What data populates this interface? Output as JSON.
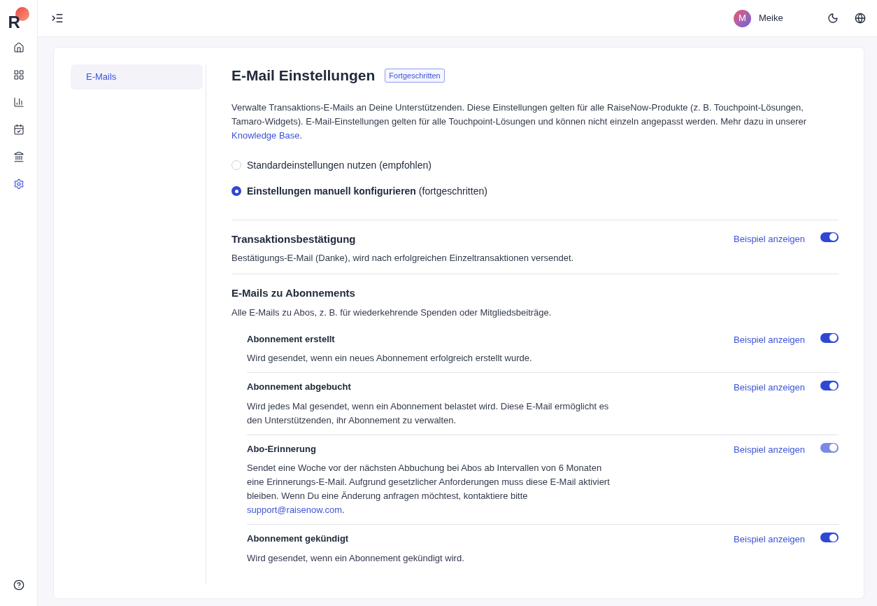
{
  "logo": "R",
  "rail": [
    {
      "kind": "home",
      "selected": false
    },
    {
      "kind": "grid",
      "selected": false
    },
    {
      "kind": "chart",
      "selected": false
    },
    {
      "kind": "calendar",
      "selected": false
    },
    {
      "kind": "bank",
      "selected": false
    },
    {
      "kind": "settings",
      "selected": true
    }
  ],
  "user": {
    "initial": "M",
    "name": "Meike"
  },
  "subnav": [
    {
      "label": "E-Mails",
      "selected": true
    }
  ],
  "title": "E-Mail Einstellungen",
  "badge": "Fortgeschritten",
  "intro": {
    "text": "Verwalte Transaktions-E-Mails an Deine Unterstützenden. Diese Einstellungen gelten für alle RaiseNow-Produkte (z. B. Touchpoint-Lösungen, Tamaro-Widgets). E-Mail-Einstellungen gelten für alle Touchpoint-Lösungen und können nicht einzeln angepasst werden. Mehr dazu in unserer ",
    "link": "Knowledge Base",
    "after": "."
  },
  "options": [
    {
      "label": "Standardeinstellungen nutzen",
      "note": "(empfohlen)",
      "selected": false
    },
    {
      "label": "Einstellungen manuell konfigurieren",
      "note": "(fortgeschritten)",
      "selected": true
    }
  ],
  "sections": [
    {
      "title": "Transaktionsbestätigung",
      "description": "Bestätigungs-E-Mail (Danke), wird nach erfolgreichen Einzeltransaktionen versendet.",
      "example": "Beispiel anzeigen",
      "on": true,
      "disabled": false
    },
    {
      "title": "E-Mails zu Abonnements",
      "description": "Alle E-Mails zu Abos, z. B. für wiederkehrende Spenden oder Mitgliedsbeiträge.",
      "items": [
        {
          "title": "Abonnement erstellt",
          "description": "Wird gesendet, wenn ein neues Abonnement erfolgreich erstellt wurde.",
          "example": "Beispiel anzeigen",
          "on": true,
          "disabled": false
        },
        {
          "title": "Abonnement abgebucht",
          "description": "Wird jedes Mal gesendet, wenn ein Abonnement belastet wird. Diese E-Mail ermöglicht es den Unterstützenden, ihr Abonnement zu verwalten.",
          "example": "Beispiel anzeigen",
          "on": true,
          "disabled": false
        },
        {
          "title": "Abo-Erinnerung",
          "description": "Sendet eine Woche vor der nächsten Abbuchung bei Abos ab Intervallen von 6 Monaten eine Erinnerungs-E-Mail. Aufgrund gesetzlicher Anforderungen muss diese E-Mail aktiviert bleiben. Wenn Du eine Änderung anfragen möchtest, kontaktiere bitte ",
          "link": "support@raisenow.com",
          "after": ".",
          "example": "Beispiel anzeigen",
          "on": true,
          "disabled": true
        },
        {
          "title": "Abonnement gekündigt",
          "description": "Wird gesendet, wenn ein Abonnement gekündigt wird.",
          "example": "Beispiel anzeigen",
          "on": true,
          "disabled": false
        }
      ]
    }
  ]
}
